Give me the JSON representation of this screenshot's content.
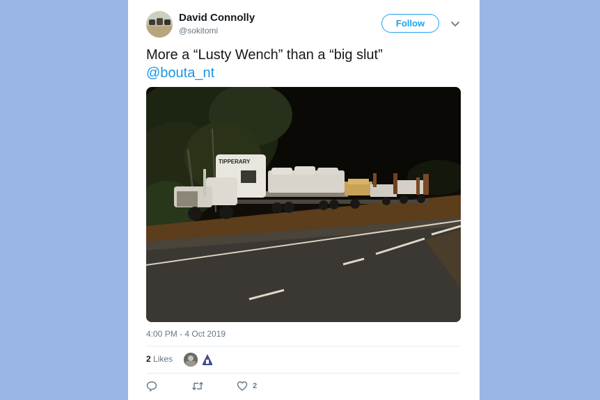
{
  "tweet": {
    "author_name": "David Connolly",
    "author_handle": "@sokitomi",
    "follow_label": "Follow",
    "text": "More a “Lusty Wench” than a “big slut”",
    "mention": "@bouta_nt",
    "timestamp": "4:00 PM - 4 Oct 2019",
    "likes_count": "2",
    "likes_label": "Likes",
    "like_action_count": "2"
  },
  "photo": {
    "truck_sign": "TIPPERARY"
  },
  "colors": {
    "background": "#9ab6e6",
    "accent": "#1da1f2",
    "mention": "#1b95e0",
    "muted": "#657786"
  },
  "icons": [
    "chevron-down-icon",
    "reply-icon",
    "retweet-icon",
    "heart-icon"
  ]
}
